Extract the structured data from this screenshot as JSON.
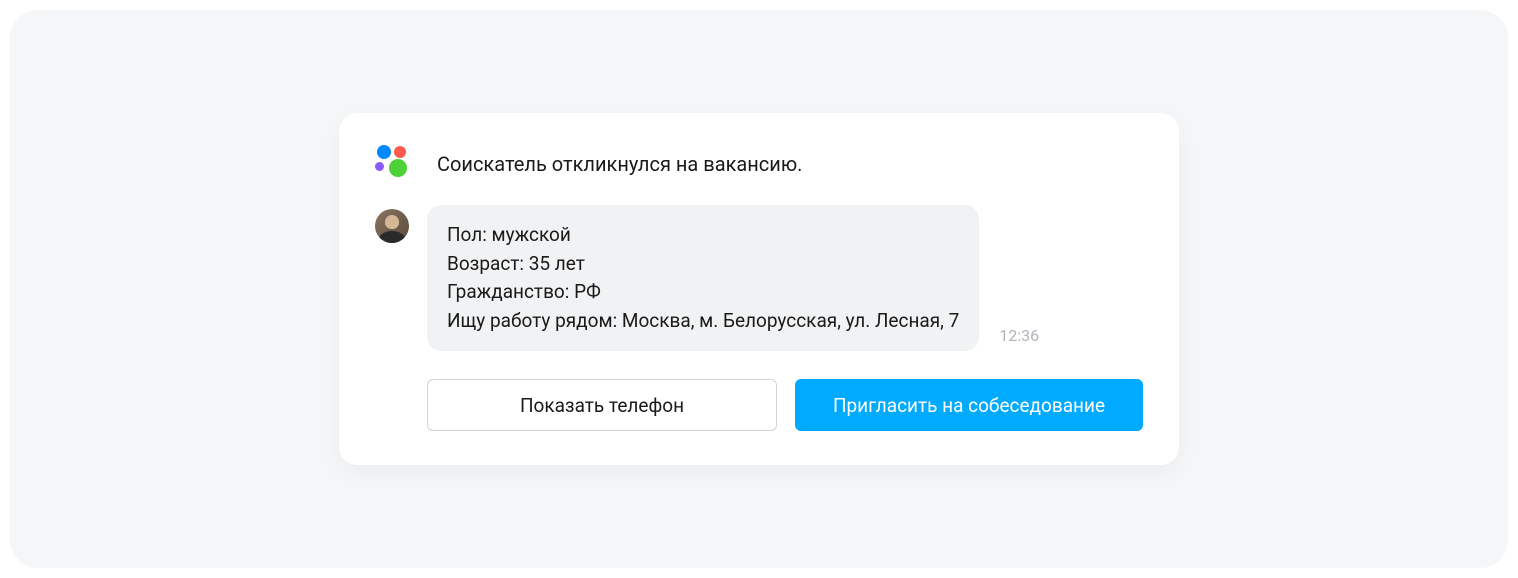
{
  "notification": {
    "title": "Соискатель откликнулся на вакансию."
  },
  "message": {
    "lines": {
      "gender": "Пол: мужской",
      "age": "Возраст: 35 лет",
      "citizenship": "Гражданство: РФ",
      "location": "Ищу работу рядом: Москва, м. Белорусская, ул. Лесная, 7"
    },
    "timestamp": "12:36"
  },
  "actions": {
    "show_phone": "Показать телефон",
    "invite": "Пригласить на собеседование"
  },
  "colors": {
    "primary": "#00aaff",
    "bubble": "#f1f2f3",
    "outer_bg": "#f5f6f7"
  }
}
